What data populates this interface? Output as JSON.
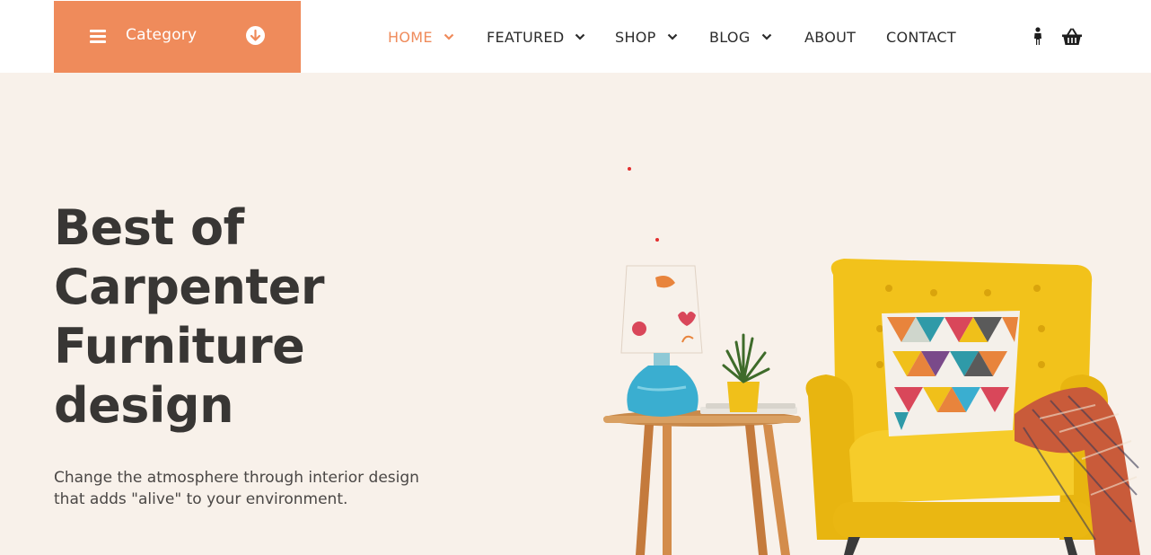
{
  "header": {
    "category_label": "Category",
    "nav": [
      {
        "label": "HOME",
        "active": true,
        "has_dropdown": true
      },
      {
        "label": "FEATURED",
        "active": false,
        "has_dropdown": true
      },
      {
        "label": "SHOP",
        "active": false,
        "has_dropdown": true
      },
      {
        "label": "BLOG",
        "active": false,
        "has_dropdown": true
      },
      {
        "label": "ABOUT",
        "active": false,
        "has_dropdown": false
      },
      {
        "label": "CONTACT",
        "active": false,
        "has_dropdown": false
      }
    ],
    "icons": [
      "user-icon",
      "cart-icon"
    ]
  },
  "hero": {
    "title_lines": [
      "Best of",
      "Carpenter",
      "Furniture",
      "design"
    ],
    "subtitle_lines": [
      "Change the atmosphere through interior design",
      "that adds \"alive\" to your environment."
    ]
  },
  "colors": {
    "accent": "#ef8b5b",
    "hero_bg": "#f8f1ea",
    "text_dark": "#383634",
    "chair_yellow": "#f2c21b"
  }
}
